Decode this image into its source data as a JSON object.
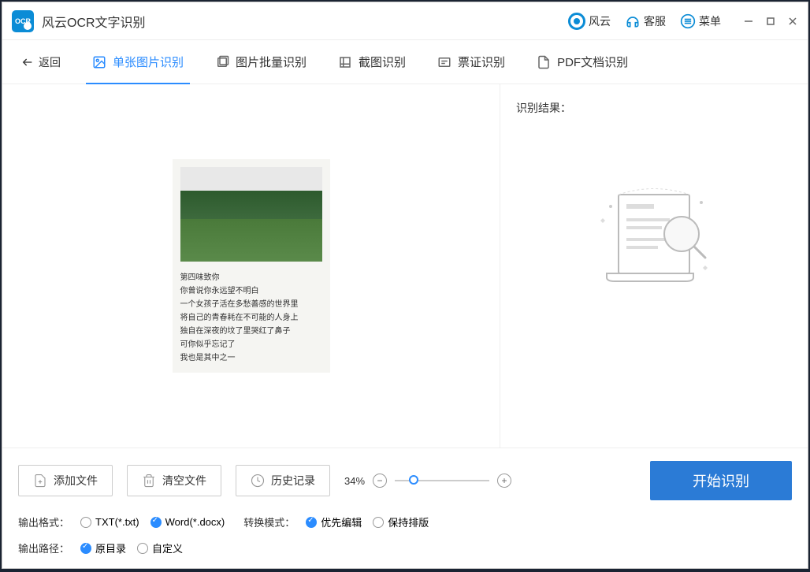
{
  "app": {
    "title": "风云OCR文字识别"
  },
  "titlebar": {
    "fengyun": "风云",
    "service": "客服",
    "menu": "菜单"
  },
  "nav": {
    "back": "返回",
    "tabs": [
      {
        "label": "单张图片识别",
        "active": true
      },
      {
        "label": "图片批量识别",
        "active": false
      },
      {
        "label": "截图识别",
        "active": false
      },
      {
        "label": "票证识别",
        "active": false
      },
      {
        "label": "PDF文档识别",
        "active": false
      }
    ]
  },
  "preview": {
    "poem_lines": [
      "第四味致你",
      "你曾说你永远望不明白",
      "一个女孩子活在多愁善感的世界里",
      "将自己的青春耗在不可能的人身上",
      "独自在深夜的坟了里哭红了鼻子",
      "可你似乎忘记了",
      "我也是其中之一"
    ]
  },
  "result": {
    "title": "识别结果："
  },
  "bottom": {
    "add_file": "添加文件",
    "clear_file": "清空文件",
    "history": "历史记录",
    "zoom": "34%",
    "start": "开始识别",
    "output_format_label": "输出格式：",
    "format_txt": "TXT(*.txt)",
    "format_word": "Word(*.docx)",
    "convert_mode_label": "转换模式：",
    "mode_edit": "优先编辑",
    "mode_layout": "保持排版",
    "output_path_label": "输出路径：",
    "path_original": "原目录",
    "path_custom": "自定义"
  }
}
